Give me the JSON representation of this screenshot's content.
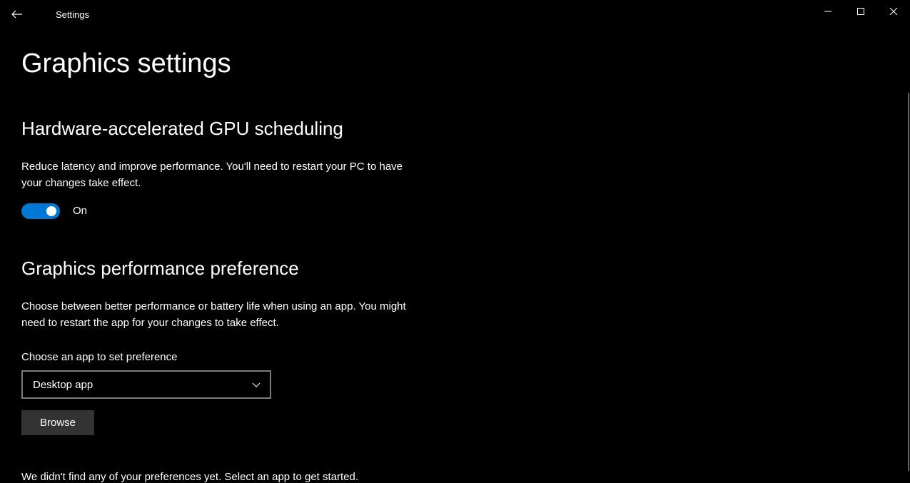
{
  "window": {
    "title": "Settings"
  },
  "page": {
    "title": "Graphics settings"
  },
  "gpu_scheduling": {
    "heading": "Hardware-accelerated GPU scheduling",
    "description": "Reduce latency and improve performance. You'll need to restart your PC to have your changes take effect.",
    "toggle_state": "On"
  },
  "performance_pref": {
    "heading": "Graphics performance preference",
    "description": "Choose between better performance or battery life when using an app. You might need to restart the app for your changes to take effect.",
    "choose_label": "Choose an app to set preference",
    "dropdown_value": "Desktop app",
    "browse_label": "Browse",
    "empty_message": "We didn't find any of your preferences yet. Select an app to get started."
  }
}
